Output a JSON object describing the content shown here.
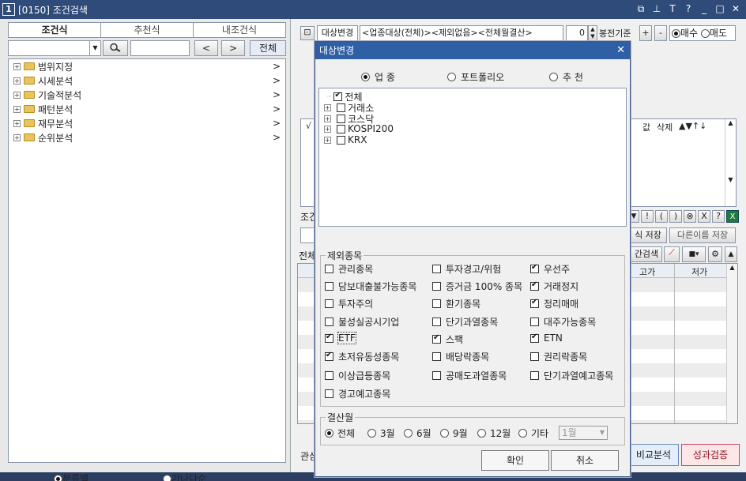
{
  "window": {
    "number": "1",
    "title": "[0150] 조건검색"
  },
  "left": {
    "tabs": [
      "조건식",
      "추천식",
      "내조건식"
    ],
    "all_button": "전체",
    "prev": "<",
    "next": ">",
    "tree": [
      {
        "label": "범위지정"
      },
      {
        "label": "시세분석"
      },
      {
        "label": "기술적분석"
      },
      {
        "label": "패턴분석"
      },
      {
        "label": "재무분석"
      },
      {
        "label": "순위분석"
      }
    ],
    "sort": {
      "by_category": "분류별",
      "alphabetical": "가나다순"
    }
  },
  "right": {
    "target_change": "대상변경",
    "target_text": "<업종대상(전체)><제외없음><전체월결산>",
    "spin_value": "0",
    "candle": "봉전기준",
    "plus": "+",
    "minus": "-",
    "buy": "매수",
    "sell": "매도",
    "check_col": "√",
    "col_value": "값",
    "col_delete": "삭제",
    "move_icons": "▲▼↑↓",
    "cond_label": "조건",
    "save": "식 저장",
    "save_as": "다른이름 저장",
    "all_label": "전체",
    "search_label": "간검색",
    "col_high": "고가",
    "col_low": "저가",
    "interest_label": "관심",
    "compare": "비교분석",
    "perf": "성과검증",
    "op_buttons": [
      "!",
      "(",
      ")",
      "⊗",
      "X",
      "?"
    ]
  },
  "dialog": {
    "title": "대상변경",
    "scope": [
      {
        "label": "업 종",
        "on": true
      },
      {
        "label": "포트폴리오",
        "on": false
      },
      {
        "label": "추 천",
        "on": false
      }
    ],
    "tree": [
      {
        "label": "전체",
        "checked": true,
        "root": true
      },
      {
        "label": "거래소",
        "checked": false
      },
      {
        "label": "코스닥",
        "checked": false
      },
      {
        "label": "KOSPI200",
        "checked": false
      },
      {
        "label": "KRX",
        "checked": false
      }
    ],
    "exclude_title": "제외종목",
    "exclude": [
      {
        "label": "관리종목",
        "checked": false
      },
      {
        "label": "투자경고/위험",
        "checked": false
      },
      {
        "label": "우선주",
        "checked": true
      },
      {
        "label": "담보대출불가능종목",
        "checked": false
      },
      {
        "label": "증거금 100% 종목",
        "checked": false
      },
      {
        "label": "거래정지",
        "checked": true
      },
      {
        "label": "투자주의",
        "checked": false
      },
      {
        "label": "환기종목",
        "checked": false
      },
      {
        "label": "정리매매",
        "checked": true
      },
      {
        "label": "불성실공시기업",
        "checked": false
      },
      {
        "label": "단기과열종목",
        "checked": false
      },
      {
        "label": "대주가능종목",
        "checked": false
      },
      {
        "label": "ETF",
        "checked": true
      },
      {
        "label": "스팩",
        "checked": true
      },
      {
        "label": "ETN",
        "checked": true
      },
      {
        "label": "초저유동성종목",
        "checked": true
      },
      {
        "label": "배당락종목",
        "checked": false
      },
      {
        "label": "권리락종목",
        "checked": false
      },
      {
        "label": "이상급등종목",
        "checked": false
      },
      {
        "label": "공매도과열종목",
        "checked": false
      },
      {
        "label": "단기과열예고종목",
        "checked": false
      },
      {
        "label": "경고예고종목",
        "checked": false
      }
    ],
    "settlement_title": "결산월",
    "months": [
      {
        "label": "전체",
        "on": true
      },
      {
        "label": "3월",
        "on": false
      },
      {
        "label": "6월",
        "on": false
      },
      {
        "label": "9월",
        "on": false
      },
      {
        "label": "12월",
        "on": false
      },
      {
        "label": "기타",
        "on": false
      }
    ],
    "month_select": "1월",
    "ok": "확인",
    "cancel": "취소"
  }
}
